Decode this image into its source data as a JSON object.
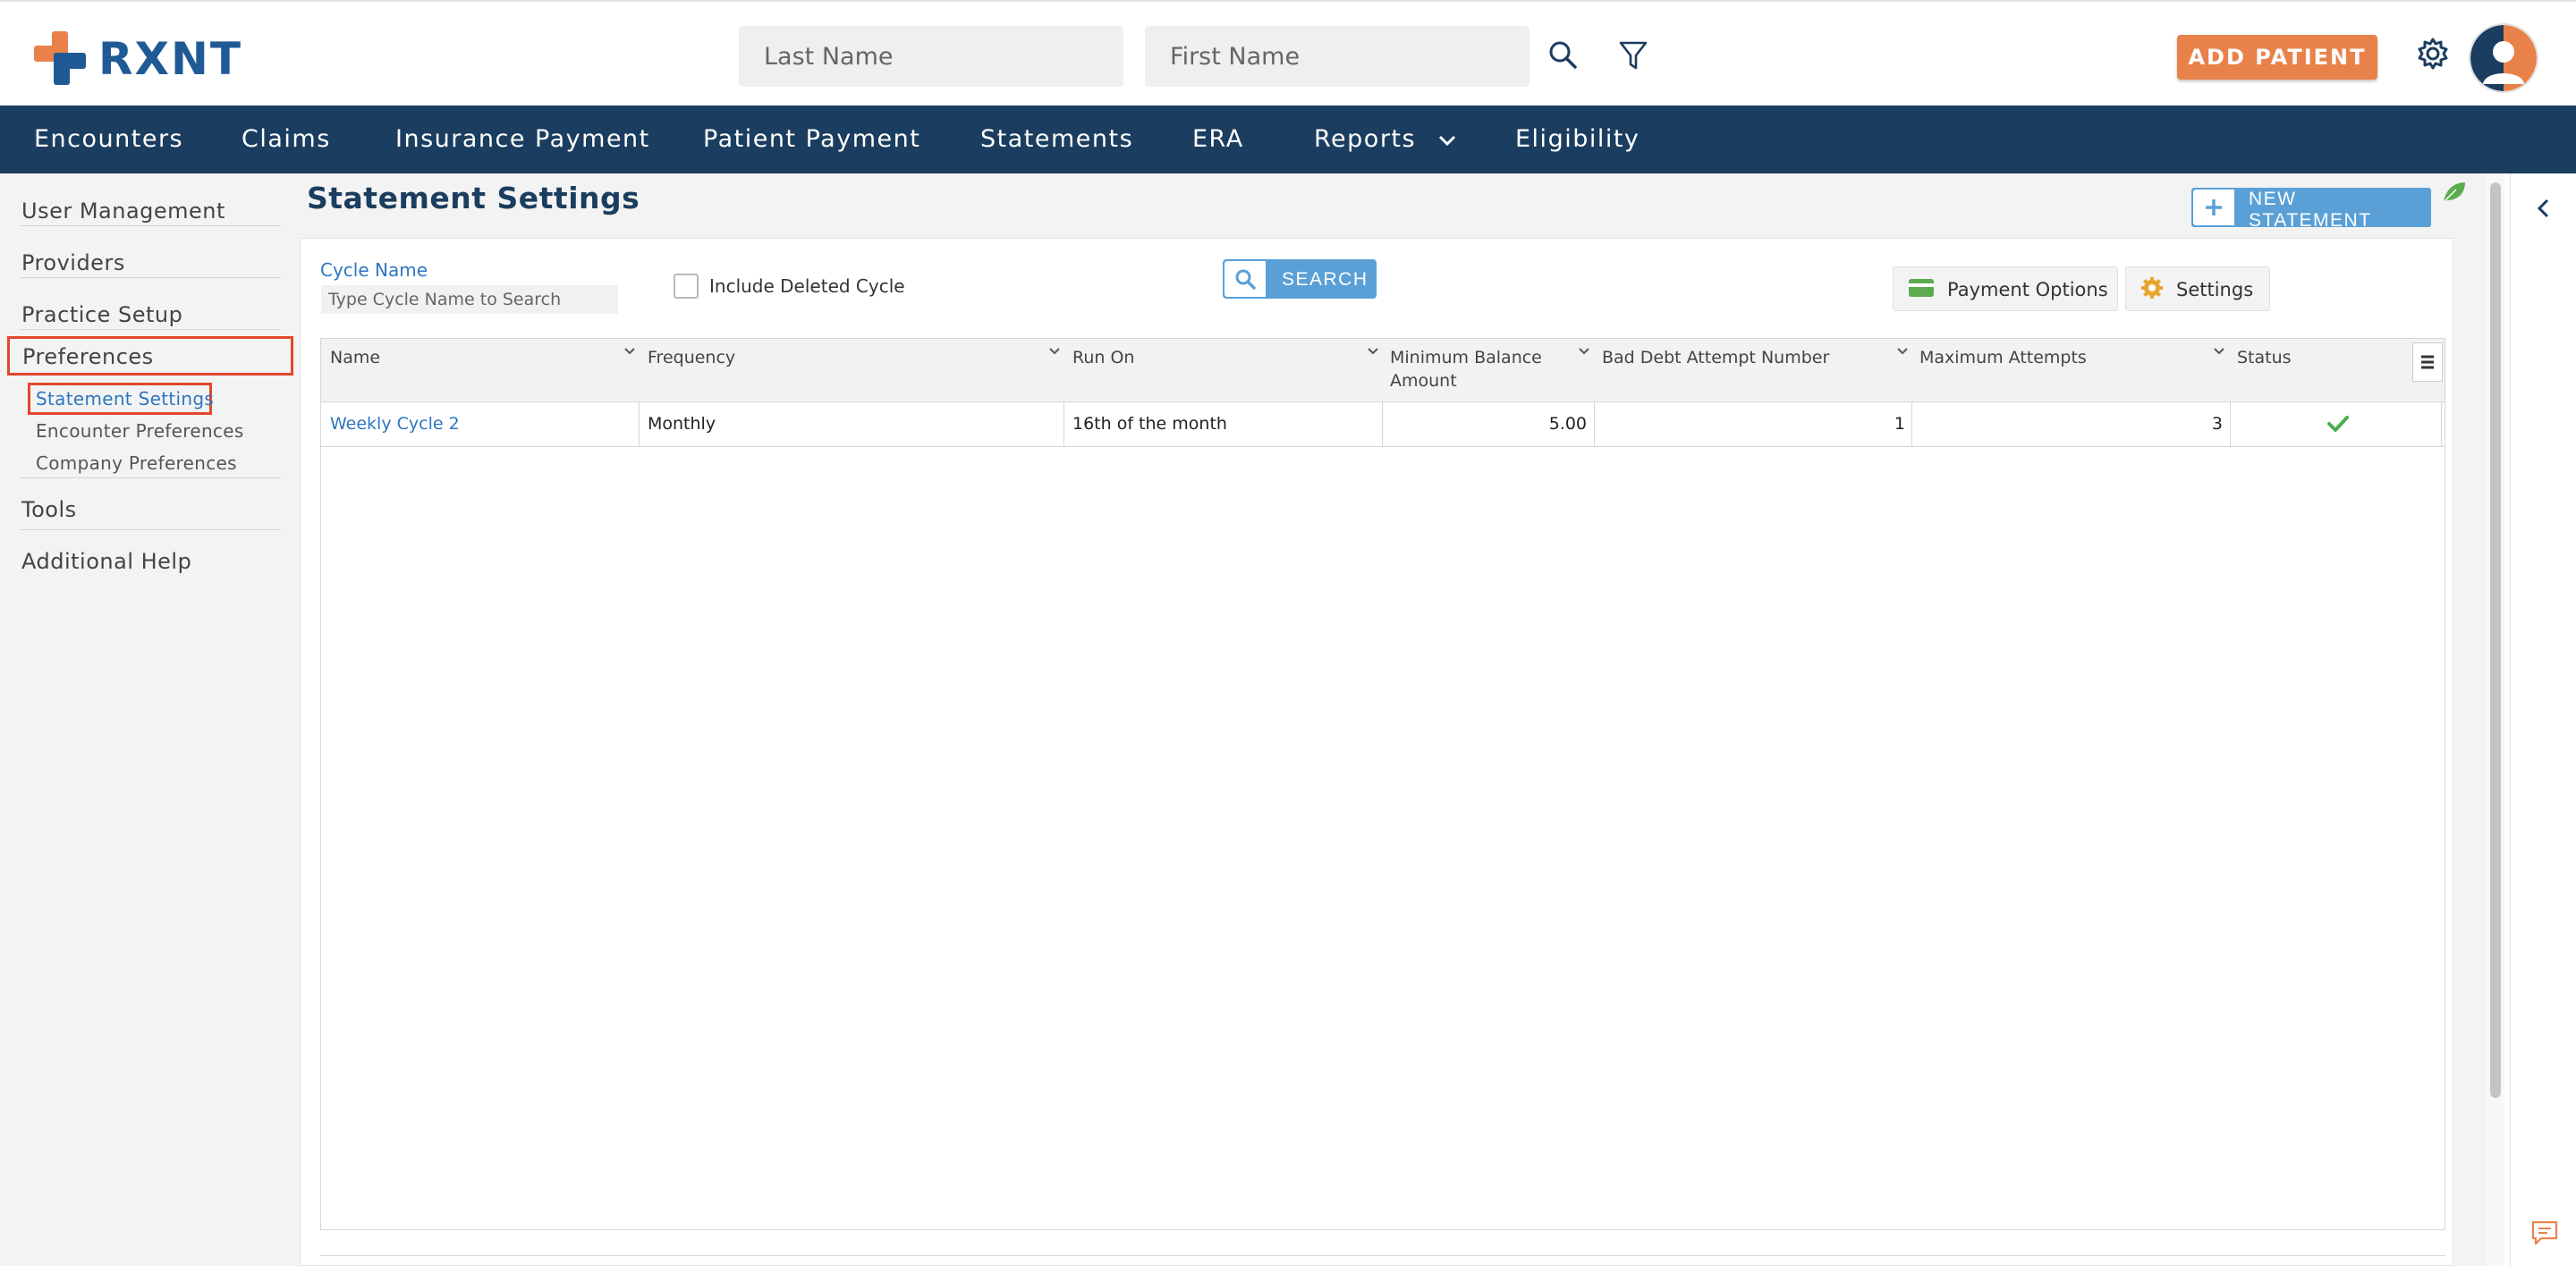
{
  "app": {
    "brand": "RXNT"
  },
  "header": {
    "last_name_placeholder": "Last Name",
    "first_name_placeholder": "First Name",
    "add_patient_label": "ADD PATIENT"
  },
  "nav": {
    "items": [
      {
        "label": "Encounters"
      },
      {
        "label": "Claims"
      },
      {
        "label": "Insurance Payment"
      },
      {
        "label": "Patient Payment"
      },
      {
        "label": "Statements"
      },
      {
        "label": "ERA"
      },
      {
        "label": "Reports"
      },
      {
        "label": "Eligibility"
      }
    ]
  },
  "sidebar": {
    "items": [
      {
        "label": "User Management"
      },
      {
        "label": "Providers"
      },
      {
        "label": "Practice Setup"
      },
      {
        "label": "Preferences"
      },
      {
        "label": "Tools"
      },
      {
        "label": "Additional Help"
      }
    ],
    "sub_items": [
      {
        "label": "Statement Settings"
      },
      {
        "label": "Encounter Preferences"
      },
      {
        "label": "Company Preferences"
      }
    ]
  },
  "page": {
    "title": "Statement Settings",
    "new_statement_label": "NEW STATEMENT"
  },
  "filters": {
    "cycle_name_label": "Cycle Name",
    "cycle_name_placeholder": "Type Cycle Name to Search",
    "include_deleted_label": "Include Deleted Cycle",
    "search_label": "SEARCH",
    "payment_options_label": "Payment Options",
    "settings_label": "Settings"
  },
  "grid": {
    "columns": [
      "Name",
      "Frequency",
      "Run On",
      "Minimum Balance Amount",
      "Bad Debt Attempt Number",
      "Maximum Attempts",
      "Status"
    ],
    "column_min_balance_line1": "Minimum Balance",
    "column_min_balance_line2": "Amount",
    "rows": [
      {
        "name": "Weekly Cycle 2",
        "frequency": "Monthly",
        "run_on": "16th of the month",
        "min_balance": "5.00",
        "bad_debt_attempt": "1",
        "max_attempts": "3",
        "status": "active"
      }
    ]
  },
  "colors": {
    "nav_bg": "#1b3d5f",
    "brand_blue": "#1f5a96",
    "accent_orange": "#e9824a",
    "link_blue": "#2e76c0",
    "button_blue": "#5aa0d6",
    "highlight_red": "#e2472c",
    "status_green": "#4caf50"
  }
}
